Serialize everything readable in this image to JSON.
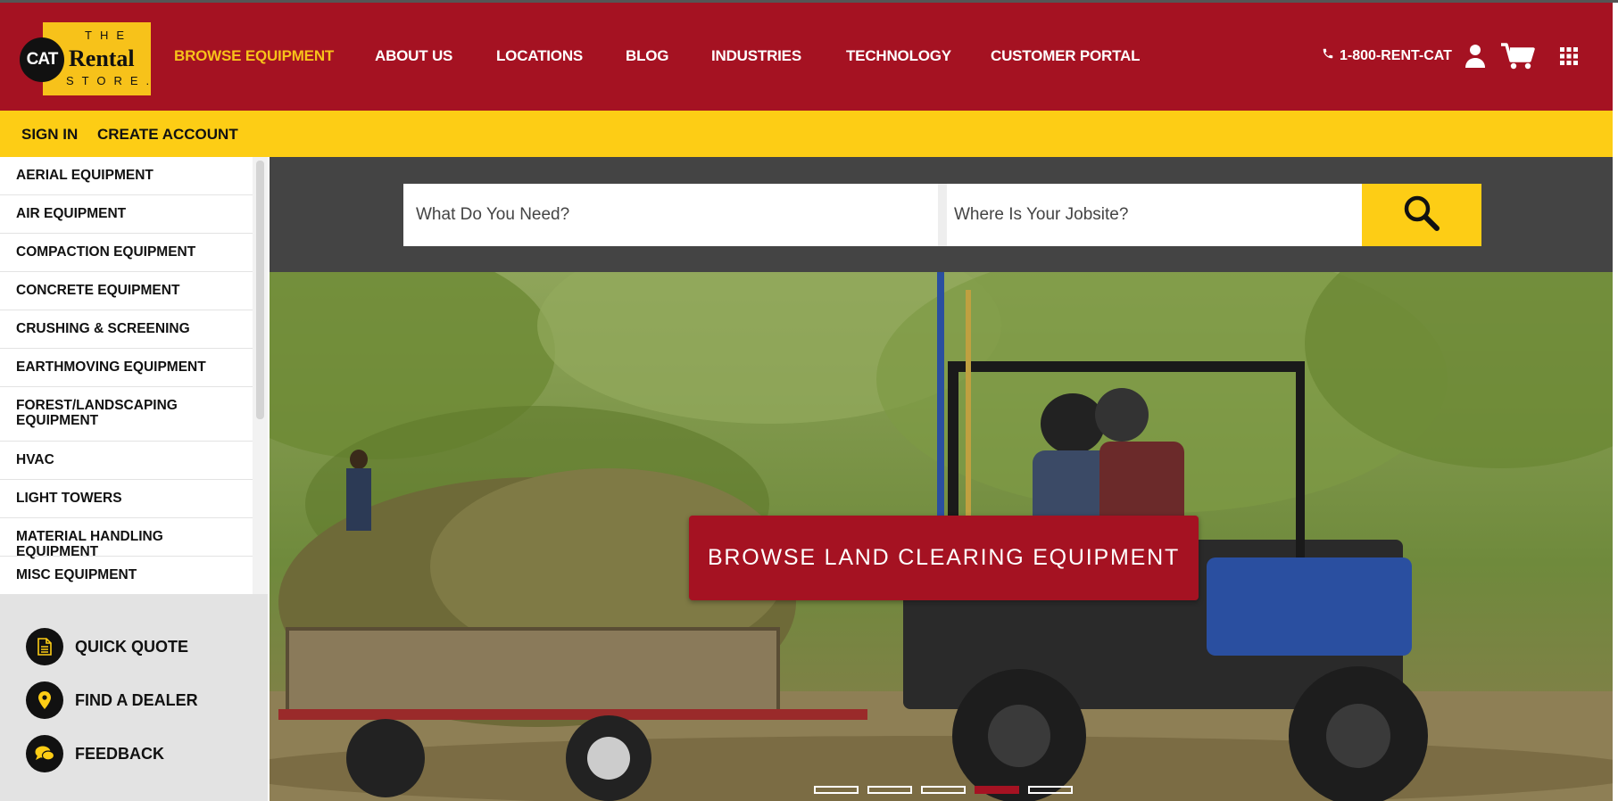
{
  "header": {
    "logo": {
      "cat": "CAT",
      "the": "THE",
      "rental": "Rental",
      "store": "STORE."
    },
    "nav": [
      {
        "label": "BROWSE EQUIPMENT",
        "active": true
      },
      {
        "label": "ABOUT US"
      },
      {
        "label": "LOCATIONS"
      },
      {
        "label": "BLOG"
      },
      {
        "label": "INDUSTRIES"
      },
      {
        "label": "TECHNOLOGY"
      },
      {
        "label": "CUSTOMER PORTAL"
      }
    ],
    "phone": "1-800-RENT-CAT",
    "icons": [
      "phone-icon",
      "user-icon",
      "cart-icon",
      "grid-menu-icon"
    ]
  },
  "subbar": {
    "sign_in": "SIGN IN",
    "create_account": "CREATE ACCOUNT"
  },
  "sidebar": {
    "categories": [
      "AERIAL EQUIPMENT",
      "AIR EQUIPMENT",
      "COMPACTION EQUIPMENT",
      "CONCRETE EQUIPMENT",
      "CRUSHING & SCREENING",
      "EARTHMOVING EQUIPMENT",
      "FOREST/LANDSCAPING EQUIPMENT",
      "HVAC",
      "LIGHT TOWERS",
      "MATERIAL HANDLING EQUIPMENT",
      "MISC EQUIPMENT"
    ],
    "quick_links": [
      {
        "label": "QUICK QUOTE",
        "icon": "document-icon"
      },
      {
        "label": "FIND A DEALER",
        "icon": "location-pin-icon"
      },
      {
        "label": "FEEDBACK",
        "icon": "chat-bubbles-icon"
      }
    ]
  },
  "search": {
    "what_placeholder": "What Do You Need?",
    "where_placeholder": "Where Is Your Jobsite?",
    "button_icon": "search-icon"
  },
  "hero": {
    "cta": "BROWSE LAND CLEARING EQUIPMENT",
    "slides_total": 5,
    "active_slide": 4
  },
  "colors": {
    "brand_red": "#a51222",
    "brand_yellow": "#fdcd15",
    "dark_strip": "#444444"
  }
}
